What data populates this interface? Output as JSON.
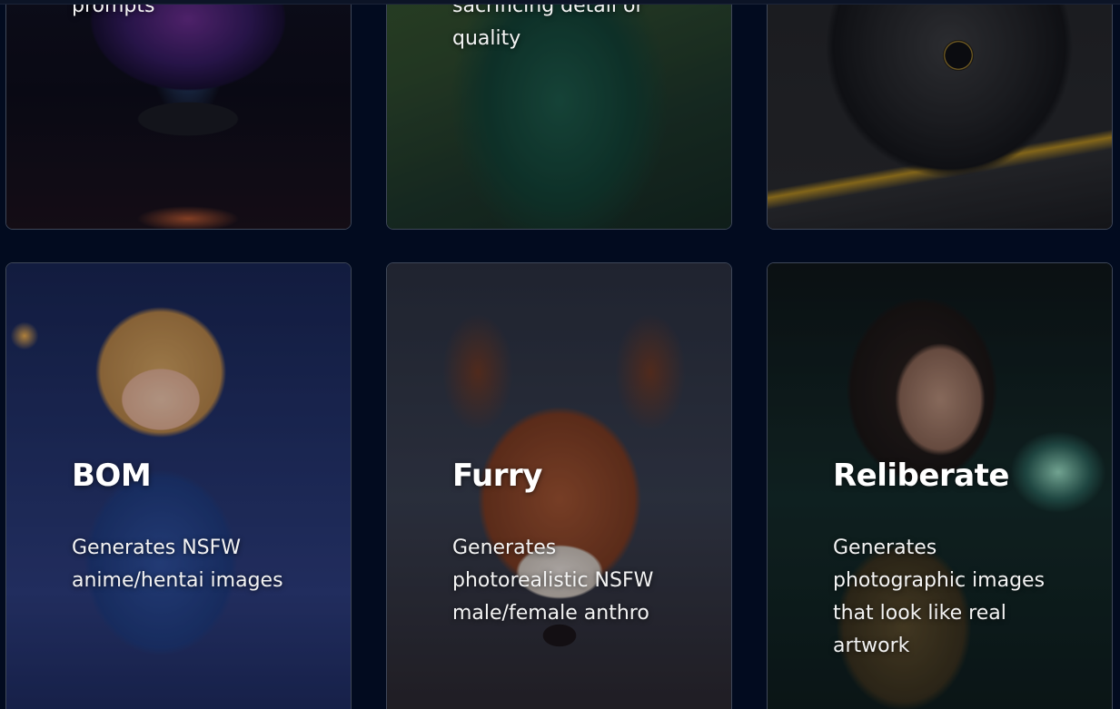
{
  "cards": [
    {
      "title": "",
      "description": "prompts",
      "image": "crystal-ball-artwork"
    },
    {
      "title": "",
      "description": "anything without sacrificing detail or quality",
      "image": "green-dress-artwork"
    },
    {
      "title": "",
      "description": "",
      "image": "mech-suit-artwork"
    },
    {
      "title": "BOM",
      "description": "Generates NSFW anime/hentai images",
      "image": "anime-girl-artwork"
    },
    {
      "title": "Furry",
      "description": "Generates photorealistic NSFW male/female anthro",
      "image": "wolf-artwork"
    },
    {
      "title": "Reliberate",
      "description": "Generates photographic images that look like real artwork",
      "image": "warrior-woman-artwork"
    }
  ],
  "colors": {
    "background": "#020b1f",
    "card_border": "#3f4758",
    "text": "#ffffff"
  }
}
